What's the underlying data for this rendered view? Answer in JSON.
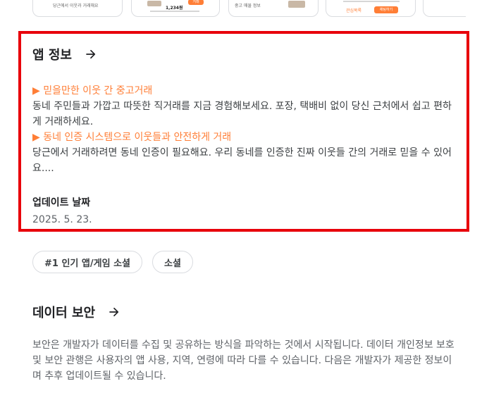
{
  "screenshots": [
    {
      "caption": "당근에서 이웃과 거래해요"
    },
    {
      "badge": "1,234원",
      "pill": "거래"
    },
    {
      "caption": "중고 매물 정보"
    },
    {
      "left_button": "관심목록",
      "right_button": "채팅하기"
    }
  ],
  "app_info": {
    "title": "앱 정보",
    "arrow_icon": "arrow-right-icon",
    "highlight_color": "#ff7e36",
    "description": [
      {
        "type": "highlight",
        "text": "▶ 믿을만한 이웃 간 중고거래"
      },
      {
        "type": "text",
        "text": "동네 주민들과 가깝고 따뜻한 직거래를 지금 경험해보세요. 포장, 택배비 없이 당신 근처에서 쉽고 편하게 거래하세요."
      },
      {
        "type": "highlight",
        "text": "▶ 동네 인증 시스템으로 이웃들과 안전하게 거래"
      },
      {
        "type": "text",
        "text": "당근에서 거래하려면 동네 인증이 필요해요. 우리 동네를 인증한 진짜 이웃들 간의 거래로 믿을 수 있어요...."
      }
    ],
    "update_label": "업데이트 날짜",
    "update_value": "2025. 5. 23."
  },
  "chips": [
    "#1 인기 앱/게임 소셜",
    "소셜"
  ],
  "data_safety": {
    "title": "데이터 보안",
    "arrow_icon": "arrow-right-icon",
    "text": "보안은 개발자가 데이터를 수집 및 공유하는 방식을 파악하는 것에서 시작됩니다. 데이터 개인정보 보호 및 보안 관행은 사용자의 앱 사용, 지역, 연령에 따라 다를 수 있습니다. 다음은 개발자가 제공한 정보이며 추후 업데이트될 수 있습니다."
  },
  "colors": {
    "frame": "#e8000b",
    "accent": "#ff7e36"
  }
}
